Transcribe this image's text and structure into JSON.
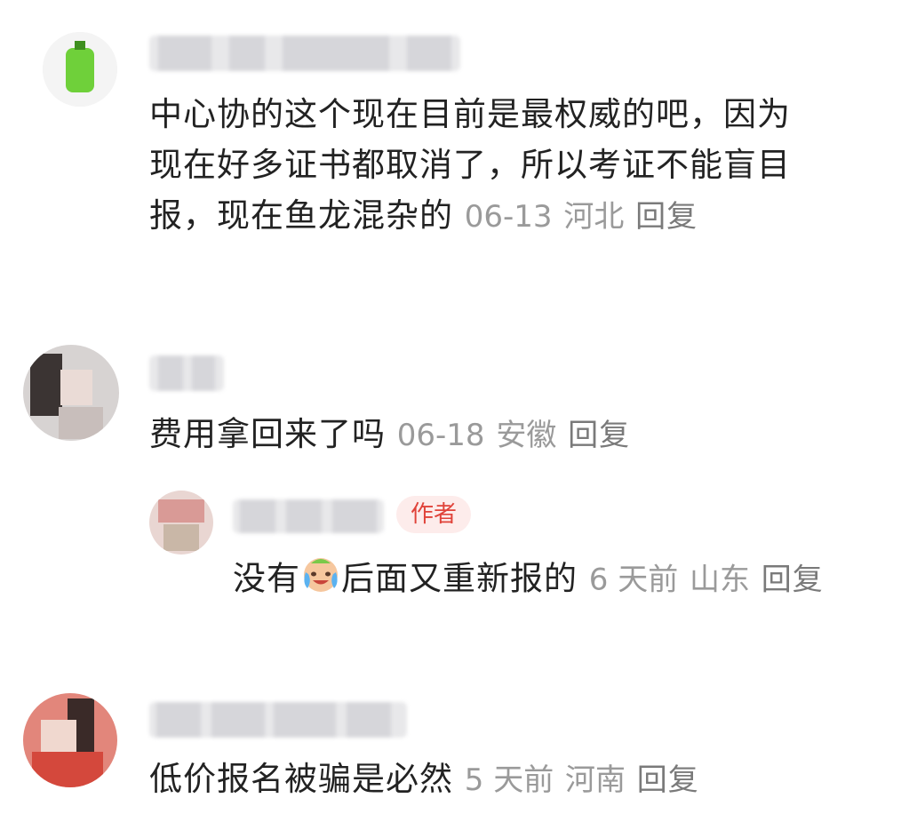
{
  "comments": [
    {
      "text": "中心协的这个现在目前是最权威的吧，因为现在好多证书都取消了，所以考证不能盲目报，现在鱼龙混杂的",
      "lines": [
        "中心协的这个现在目前是最权威的吧，因为",
        "现在好多证书都取消了，所以考证不能盲目",
        "报，现在鱼龙混杂的"
      ],
      "date": "06-13",
      "location": "河北",
      "reply": "回复"
    },
    {
      "text": "费用拿回来了吗",
      "date": "06-18",
      "location": "安徽",
      "reply": "回复",
      "sub_reply": {
        "author_tag": "作者",
        "text_before": "没有",
        "emoji": "crying-laughing-emoji",
        "text_after": "后面又重新报的",
        "date": "6 天前",
        "location": "山东",
        "reply": "回复"
      }
    },
    {
      "text": "低价报名被骗是必然",
      "date": "5 天前",
      "location": "河南",
      "reply": "回复"
    }
  ],
  "colors": {
    "text": "#222222",
    "meta": "#9a9a9a",
    "author_tag_bg": "#fdeceb",
    "author_tag_text": "#e0433a"
  }
}
